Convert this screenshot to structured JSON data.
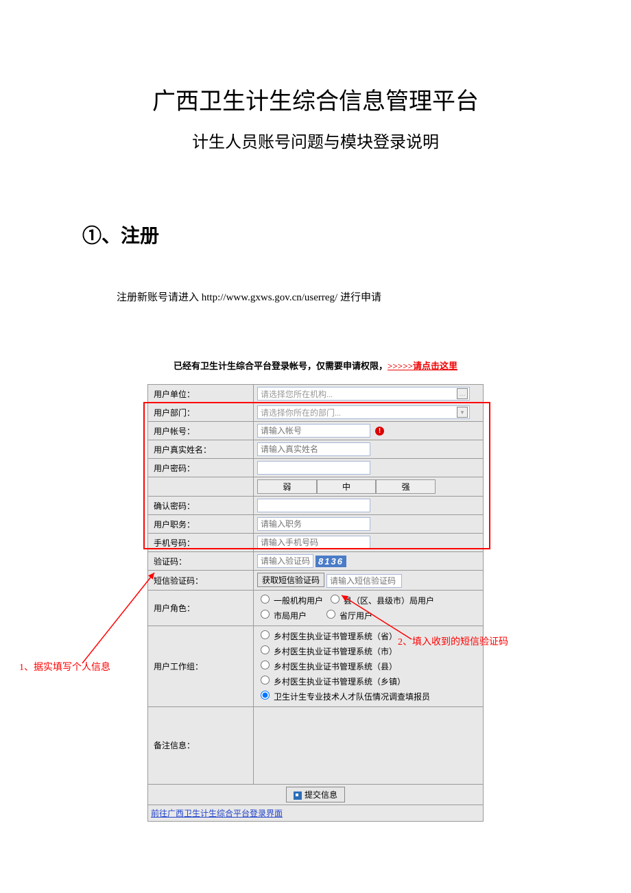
{
  "title": "广西卫生计生综合信息管理平台",
  "subtitle": "计生人员账号问题与模块登录说明",
  "section": "①、注册",
  "reg_text_prefix": "注册新账号请进入 ",
  "reg_url": "http://www.gxws.gov.cn/userreg/",
  "reg_text_suffix": "  进行申请",
  "notice_text": "已经有卫生计生综合平台登录帐号，仅需要申请权限，",
  "notice_link": ">>>>>请点击这里",
  "form": {
    "unit": {
      "label": "用户单位：",
      "placeholder": "请选择您所在机构..."
    },
    "dept": {
      "label": "用户部门：",
      "placeholder": "请选择你所在的部门..."
    },
    "account": {
      "label": "用户帐号：",
      "placeholder": "请输入帐号"
    },
    "realname": {
      "label": "用户真实姓名：",
      "placeholder": "请输入真实姓名"
    },
    "password": {
      "label": "用户密码："
    },
    "pwd_weak": "弱",
    "pwd_mid": "中",
    "pwd_strong": "强",
    "confirm": {
      "label": "确认密码："
    },
    "duty": {
      "label": "用户职务：",
      "placeholder": "请输入职务"
    },
    "mobile": {
      "label": "手机号码：",
      "placeholder": "请输入手机号码"
    },
    "captcha": {
      "label": "验证码：",
      "placeholder": "请输入验证码",
      "code": "8136"
    },
    "sms": {
      "label": "短信验证码：",
      "btn": "获取短信验证码",
      "placeholder": "请输入短信验证码"
    },
    "role": {
      "label": "用户角色：",
      "r1": "一般机构用户",
      "r2": "县（区、县级市）局用户",
      "r3": "市局用户",
      "r4": "省厅用户"
    },
    "workgroup": {
      "label": "用户工作组：",
      "g1": "乡村医生执业证书管理系统（省）",
      "g2": "乡村医生执业证书管理系统（市）",
      "g3": "乡村医生执业证书管理系统（县）",
      "g4": "乡村医生执业证书管理系统（乡镇）",
      "g5": "卫生计生专业技术人才队伍情况调查填报员"
    },
    "remark": {
      "label": "备注信息："
    },
    "submit": "提交信息",
    "back": "前往广西卫生计生综合平台登录界面"
  },
  "anno1": "1、据实填写个人信息",
  "anno2": "2、填入收到的短信验证码"
}
